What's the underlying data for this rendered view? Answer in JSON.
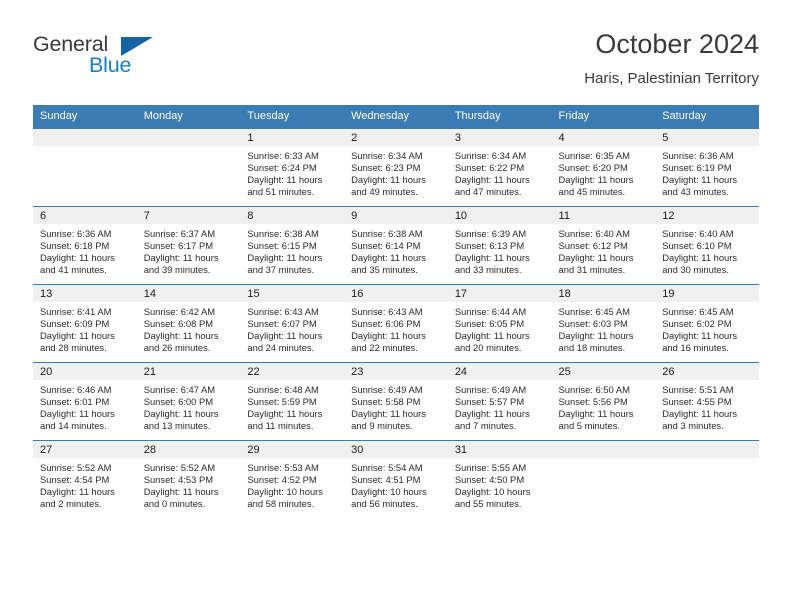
{
  "brand": {
    "name_part1": "General",
    "name_part2": "Blue",
    "triangle_color": "#1464a5",
    "blue_color": "#1f7ec2"
  },
  "header": {
    "month_title": "October 2024",
    "location": "Haris, Palestinian Territory"
  },
  "theme": {
    "header_row_bg": "#3b7cb5",
    "daynum_band_bg": "#f0f0f0",
    "grid_line": "#3b7cb5"
  },
  "weekday_headers": [
    "Sunday",
    "Monday",
    "Tuesday",
    "Wednesday",
    "Thursday",
    "Friday",
    "Saturday"
  ],
  "weeks": [
    [
      {
        "day": "",
        "empty": true
      },
      {
        "day": "",
        "empty": true
      },
      {
        "day": "1",
        "sunrise": "Sunrise: 6:33 AM",
        "sunset": "Sunset: 6:24 PM",
        "daylight_line1": "Daylight: 11 hours",
        "daylight_line2": "and 51 minutes."
      },
      {
        "day": "2",
        "sunrise": "Sunrise: 6:34 AM",
        "sunset": "Sunset: 6:23 PM",
        "daylight_line1": "Daylight: 11 hours",
        "daylight_line2": "and 49 minutes."
      },
      {
        "day": "3",
        "sunrise": "Sunrise: 6:34 AM",
        "sunset": "Sunset: 6:22 PM",
        "daylight_line1": "Daylight: 11 hours",
        "daylight_line2": "and 47 minutes."
      },
      {
        "day": "4",
        "sunrise": "Sunrise: 6:35 AM",
        "sunset": "Sunset: 6:20 PM",
        "daylight_line1": "Daylight: 11 hours",
        "daylight_line2": "and 45 minutes."
      },
      {
        "day": "5",
        "sunrise": "Sunrise: 6:36 AM",
        "sunset": "Sunset: 6:19 PM",
        "daylight_line1": "Daylight: 11 hours",
        "daylight_line2": "and 43 minutes."
      }
    ],
    [
      {
        "day": "6",
        "sunrise": "Sunrise: 6:36 AM",
        "sunset": "Sunset: 6:18 PM",
        "daylight_line1": "Daylight: 11 hours",
        "daylight_line2": "and 41 minutes."
      },
      {
        "day": "7",
        "sunrise": "Sunrise: 6:37 AM",
        "sunset": "Sunset: 6:17 PM",
        "daylight_line1": "Daylight: 11 hours",
        "daylight_line2": "and 39 minutes."
      },
      {
        "day": "8",
        "sunrise": "Sunrise: 6:38 AM",
        "sunset": "Sunset: 6:15 PM",
        "daylight_line1": "Daylight: 11 hours",
        "daylight_line2": "and 37 minutes."
      },
      {
        "day": "9",
        "sunrise": "Sunrise: 6:38 AM",
        "sunset": "Sunset: 6:14 PM",
        "daylight_line1": "Daylight: 11 hours",
        "daylight_line2": "and 35 minutes."
      },
      {
        "day": "10",
        "sunrise": "Sunrise: 6:39 AM",
        "sunset": "Sunset: 6:13 PM",
        "daylight_line1": "Daylight: 11 hours",
        "daylight_line2": "and 33 minutes."
      },
      {
        "day": "11",
        "sunrise": "Sunrise: 6:40 AM",
        "sunset": "Sunset: 6:12 PM",
        "daylight_line1": "Daylight: 11 hours",
        "daylight_line2": "and 31 minutes."
      },
      {
        "day": "12",
        "sunrise": "Sunrise: 6:40 AM",
        "sunset": "Sunset: 6:10 PM",
        "daylight_line1": "Daylight: 11 hours",
        "daylight_line2": "and 30 minutes."
      }
    ],
    [
      {
        "day": "13",
        "sunrise": "Sunrise: 6:41 AM",
        "sunset": "Sunset: 6:09 PM",
        "daylight_line1": "Daylight: 11 hours",
        "daylight_line2": "and 28 minutes."
      },
      {
        "day": "14",
        "sunrise": "Sunrise: 6:42 AM",
        "sunset": "Sunset: 6:08 PM",
        "daylight_line1": "Daylight: 11 hours",
        "daylight_line2": "and 26 minutes."
      },
      {
        "day": "15",
        "sunrise": "Sunrise: 6:43 AM",
        "sunset": "Sunset: 6:07 PM",
        "daylight_line1": "Daylight: 11 hours",
        "daylight_line2": "and 24 minutes."
      },
      {
        "day": "16",
        "sunrise": "Sunrise: 6:43 AM",
        "sunset": "Sunset: 6:06 PM",
        "daylight_line1": "Daylight: 11 hours",
        "daylight_line2": "and 22 minutes."
      },
      {
        "day": "17",
        "sunrise": "Sunrise: 6:44 AM",
        "sunset": "Sunset: 6:05 PM",
        "daylight_line1": "Daylight: 11 hours",
        "daylight_line2": "and 20 minutes."
      },
      {
        "day": "18",
        "sunrise": "Sunrise: 6:45 AM",
        "sunset": "Sunset: 6:03 PM",
        "daylight_line1": "Daylight: 11 hours",
        "daylight_line2": "and 18 minutes."
      },
      {
        "day": "19",
        "sunrise": "Sunrise: 6:45 AM",
        "sunset": "Sunset: 6:02 PM",
        "daylight_line1": "Daylight: 11 hours",
        "daylight_line2": "and 16 minutes."
      }
    ],
    [
      {
        "day": "20",
        "sunrise": "Sunrise: 6:46 AM",
        "sunset": "Sunset: 6:01 PM",
        "daylight_line1": "Daylight: 11 hours",
        "daylight_line2": "and 14 minutes."
      },
      {
        "day": "21",
        "sunrise": "Sunrise: 6:47 AM",
        "sunset": "Sunset: 6:00 PM",
        "daylight_line1": "Daylight: 11 hours",
        "daylight_line2": "and 13 minutes."
      },
      {
        "day": "22",
        "sunrise": "Sunrise: 6:48 AM",
        "sunset": "Sunset: 5:59 PM",
        "daylight_line1": "Daylight: 11 hours",
        "daylight_line2": "and 11 minutes."
      },
      {
        "day": "23",
        "sunrise": "Sunrise: 6:49 AM",
        "sunset": "Sunset: 5:58 PM",
        "daylight_line1": "Daylight: 11 hours",
        "daylight_line2": "and 9 minutes."
      },
      {
        "day": "24",
        "sunrise": "Sunrise: 6:49 AM",
        "sunset": "Sunset: 5:57 PM",
        "daylight_line1": "Daylight: 11 hours",
        "daylight_line2": "and 7 minutes."
      },
      {
        "day": "25",
        "sunrise": "Sunrise: 6:50 AM",
        "sunset": "Sunset: 5:56 PM",
        "daylight_line1": "Daylight: 11 hours",
        "daylight_line2": "and 5 minutes."
      },
      {
        "day": "26",
        "sunrise": "Sunrise: 5:51 AM",
        "sunset": "Sunset: 4:55 PM",
        "daylight_line1": "Daylight: 11 hours",
        "daylight_line2": "and 3 minutes."
      }
    ],
    [
      {
        "day": "27",
        "sunrise": "Sunrise: 5:52 AM",
        "sunset": "Sunset: 4:54 PM",
        "daylight_line1": "Daylight: 11 hours",
        "daylight_line2": "and 2 minutes."
      },
      {
        "day": "28",
        "sunrise": "Sunrise: 5:52 AM",
        "sunset": "Sunset: 4:53 PM",
        "daylight_line1": "Daylight: 11 hours",
        "daylight_line2": "and 0 minutes."
      },
      {
        "day": "29",
        "sunrise": "Sunrise: 5:53 AM",
        "sunset": "Sunset: 4:52 PM",
        "daylight_line1": "Daylight: 10 hours",
        "daylight_line2": "and 58 minutes."
      },
      {
        "day": "30",
        "sunrise": "Sunrise: 5:54 AM",
        "sunset": "Sunset: 4:51 PM",
        "daylight_line1": "Daylight: 10 hours",
        "daylight_line2": "and 56 minutes."
      },
      {
        "day": "31",
        "sunrise": "Sunrise: 5:55 AM",
        "sunset": "Sunset: 4:50 PM",
        "daylight_line1": "Daylight: 10 hours",
        "daylight_line2": "and 55 minutes."
      },
      {
        "day": "",
        "empty": true
      },
      {
        "day": "",
        "empty": true
      }
    ]
  ]
}
